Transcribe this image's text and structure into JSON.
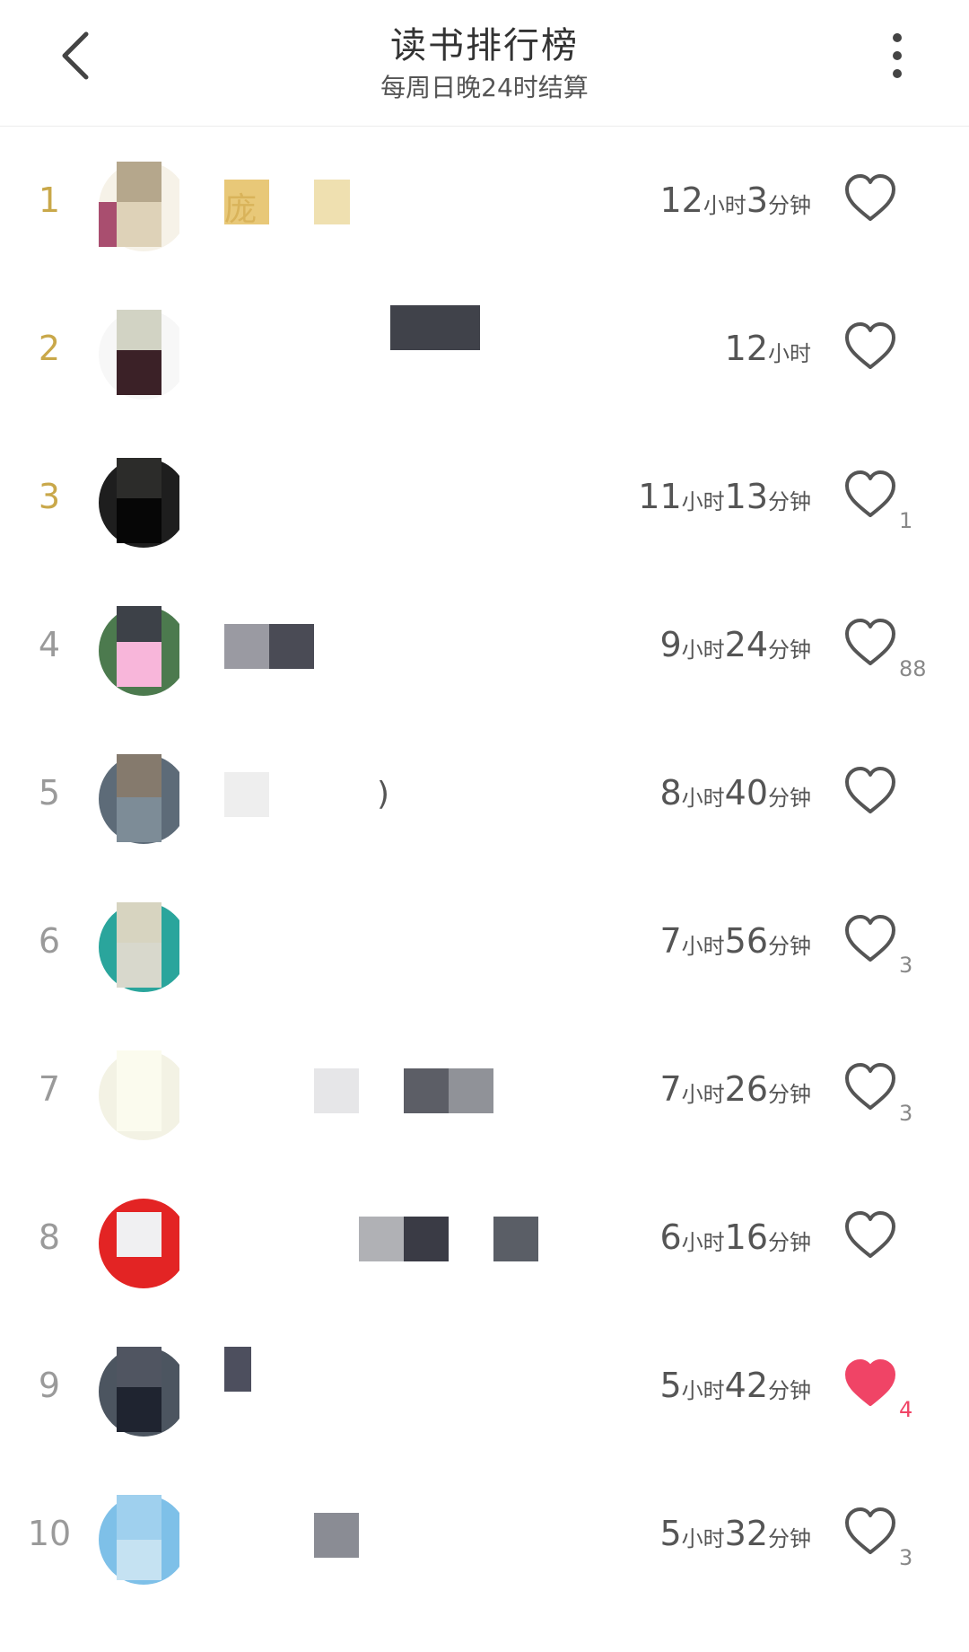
{
  "header": {
    "title": "读书排行榜",
    "subtitle": "每周日晚24时结算"
  },
  "icons": {
    "back": "chevron-left-icon",
    "more": "more-vertical-icon",
    "like": "heart-icon"
  },
  "colors": {
    "gold_rank": "#c9a84a",
    "liked_heart": "#f04466",
    "heart_outline": "#555555"
  },
  "rows": [
    {
      "rank": "1",
      "name": "庞",
      "time": [
        {
          "n": "12",
          "u": "小时"
        },
        {
          "n": "3",
          "u": "分钟"
        }
      ],
      "likes": "",
      "liked": false,
      "avatar": {
        "circle": "#f6f2e8",
        "blocks": [
          [
            "#b5a78c",
            20,
            0,
            50,
            45
          ],
          [
            "#a94e6f",
            -20,
            45,
            48,
            50
          ],
          [
            "#ded2b8",
            20,
            45,
            50,
            50
          ]
        ]
      },
      "blurs": [
        [
          "#e8c878",
          0,
          0,
          50
        ],
        [
          "#efe0b0",
          100,
          0,
          40
        ]
      ]
    },
    {
      "rank": "2",
      "name": "",
      "time": [
        {
          "n": "12",
          "u": "小时"
        }
      ],
      "likes": "",
      "liked": false,
      "avatar": {
        "circle": "#f7f7f7",
        "blocks": [
          [
            "#d2d3c4",
            20,
            0,
            50,
            45
          ],
          [
            "#3b2127",
            20,
            45,
            50,
            50
          ]
        ]
      },
      "blurs": [
        [
          "#40424a",
          185,
          -25,
          100
        ]
      ]
    },
    {
      "rank": "3",
      "name": "",
      "time": [
        {
          "n": "11",
          "u": "小时"
        },
        {
          "n": "13",
          "u": "分钟"
        }
      ],
      "likes": "1",
      "liked": false,
      "avatar": {
        "circle": "#1e1e1e",
        "blocks": [
          [
            "#2c2c2a",
            20,
            0,
            50,
            45
          ],
          [
            "#060606",
            20,
            45,
            50,
            50
          ]
        ]
      },
      "blurs": []
    },
    {
      "rank": "4",
      "name": "",
      "time": [
        {
          "n": "9",
          "u": "小时"
        },
        {
          "n": "24",
          "u": "分钟"
        }
      ],
      "likes": "88",
      "liked": false,
      "avatar": {
        "circle": "#4c7a4e",
        "blocks": [
          [
            "#3d4148",
            20,
            -10,
            50,
            50
          ],
          [
            "#f8b6da",
            20,
            40,
            50,
            50
          ]
        ]
      },
      "blurs": [
        [
          "#9a9aa2",
          0,
          0,
          50
        ],
        [
          "#4a4b55",
          50,
          0,
          50
        ]
      ]
    },
    {
      "rank": "5",
      "name": ")",
      "time": [
        {
          "n": "8",
          "u": "小时"
        },
        {
          "n": "40",
          "u": "分钟"
        }
      ],
      "likes": "",
      "liked": false,
      "avatar": {
        "circle": "#5d6b78",
        "blocks": [
          [
            "#857a6d",
            20,
            0,
            50,
            48
          ],
          [
            "#7d8c97",
            20,
            48,
            50,
            50
          ]
        ]
      },
      "blurs": [
        [
          "#eeeeee",
          0,
          0,
          50
        ]
      ]
    },
    {
      "rank": "6",
      "name": "",
      "time": [
        {
          "n": "7",
          "u": "小时"
        },
        {
          "n": "56",
          "u": "分钟"
        }
      ],
      "likes": "3",
      "liked": false,
      "avatar": {
        "circle": "#2aa59c",
        "blocks": [
          [
            "#d7d4c0",
            20,
            -10,
            50,
            55
          ],
          [
            "#d8d8cc",
            20,
            45,
            50,
            50
          ]
        ]
      },
      "blurs": []
    },
    {
      "rank": "7",
      "name": "",
      "time": [
        {
          "n": "7",
          "u": "小时"
        },
        {
          "n": "26",
          "u": "分钟"
        }
      ],
      "likes": "3",
      "liked": false,
      "avatar": {
        "circle": "#f3f2e4",
        "blocks": [
          [
            "#fbfbee",
            20,
            -20,
            50,
            110
          ]
        ]
      },
      "blurs": [
        [
          "#e6e6e8",
          100,
          0,
          50
        ],
        [
          "#5c5e66",
          200,
          0,
          50
        ],
        [
          "#909298",
          250,
          0,
          50
        ]
      ]
    },
    {
      "rank": "8",
      "name": "",
      "time": [
        {
          "n": "6",
          "u": "小时"
        },
        {
          "n": "16",
          "u": "分钟"
        }
      ],
      "likes": "",
      "liked": false,
      "avatar": {
        "circle": "#e32424",
        "blocks": [
          [
            "#f0f0f2",
            20,
            15,
            50,
            50
          ]
        ]
      },
      "blurs": [
        [
          "#b0b1b5",
          150,
          0,
          50
        ],
        [
          "#3a3b45",
          200,
          0,
          50
        ],
        [
          "#5a5e66",
          300,
          0,
          50
        ]
      ]
    },
    {
      "rank": "9",
      "name": "",
      "time": [
        {
          "n": "5",
          "u": "小时"
        },
        {
          "n": "42",
          "u": "分钟"
        }
      ],
      "likes": "4",
      "liked": true,
      "avatar": {
        "circle": "#4c5560",
        "blocks": [
          [
            "#505561",
            20,
            0,
            50,
            45
          ],
          [
            "#1f2430",
            20,
            45,
            50,
            50
          ]
        ]
      },
      "blurs": [
        [
          "#4d4f5e",
          0,
          -20,
          30
        ]
      ]
    },
    {
      "rank": "10",
      "name": "",
      "time": [
        {
          "n": "5",
          "u": "小时"
        },
        {
          "n": "32",
          "u": "分钟"
        }
      ],
      "likes": "3",
      "liked": false,
      "avatar": {
        "circle": "#7ec0e8",
        "blocks": [
          [
            "#9fd0ee",
            20,
            0,
            50,
            50
          ],
          [
            "#c5e2f2",
            20,
            50,
            50,
            45
          ]
        ]
      },
      "blurs": [
        [
          "#8a8c94",
          100,
          0,
          50
        ]
      ]
    }
  ]
}
